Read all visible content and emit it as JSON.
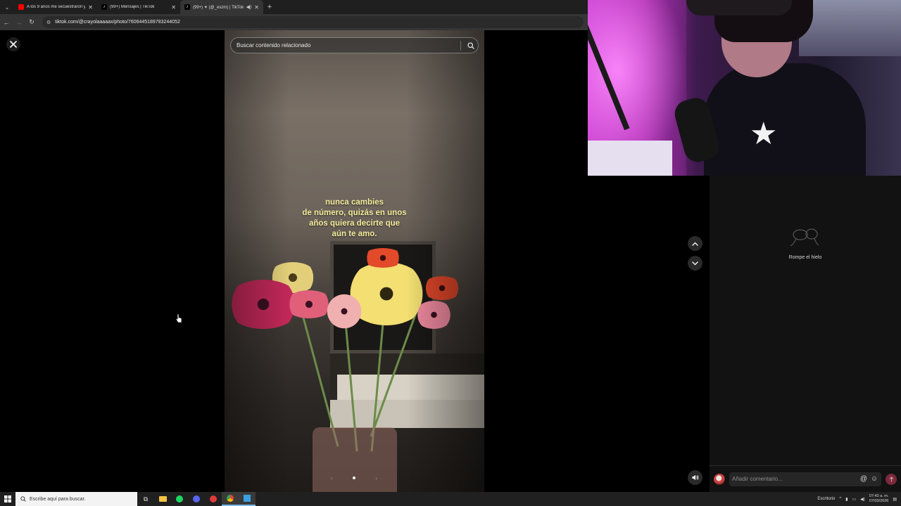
{
  "browser": {
    "tabs": [
      {
        "title": "A los 9 años me secuestraron y",
        "favicon": "youtube-icon",
        "active": false
      },
      {
        "title": "(99+) Mensajes | TikTok",
        "favicon": "tiktok-icon",
        "active": false
      },
      {
        "title": "(99+) ✦ (@_eszm) | TikTok",
        "favicon": "tiktok-icon",
        "active": true
      }
    ],
    "url": "tiktok.com/@crayolaaaaax/photo/7606445189783244052"
  },
  "viewer": {
    "search_placeholder": "Buscar contenido relacionado",
    "overlay_lines": [
      "nunca cambies",
      "de número, quizás en unos",
      "años quiera decirte que",
      "aún te amo."
    ],
    "carousel": {
      "current": 1,
      "total": 1
    }
  },
  "comments": {
    "empty_label": "Rompe el hielo",
    "input_placeholder": "Añadir comentario..."
  },
  "taskbar": {
    "search_placeholder": "Escribe aquí para buscar.",
    "desktop_label": "Escritorio",
    "time": "07:43 a. m.",
    "date": "07/03/2026"
  },
  "colors": {
    "overlay_text": "#f4ec9c",
    "post_button": "#7a2a3b",
    "webcam_light": "#c93fcf"
  }
}
